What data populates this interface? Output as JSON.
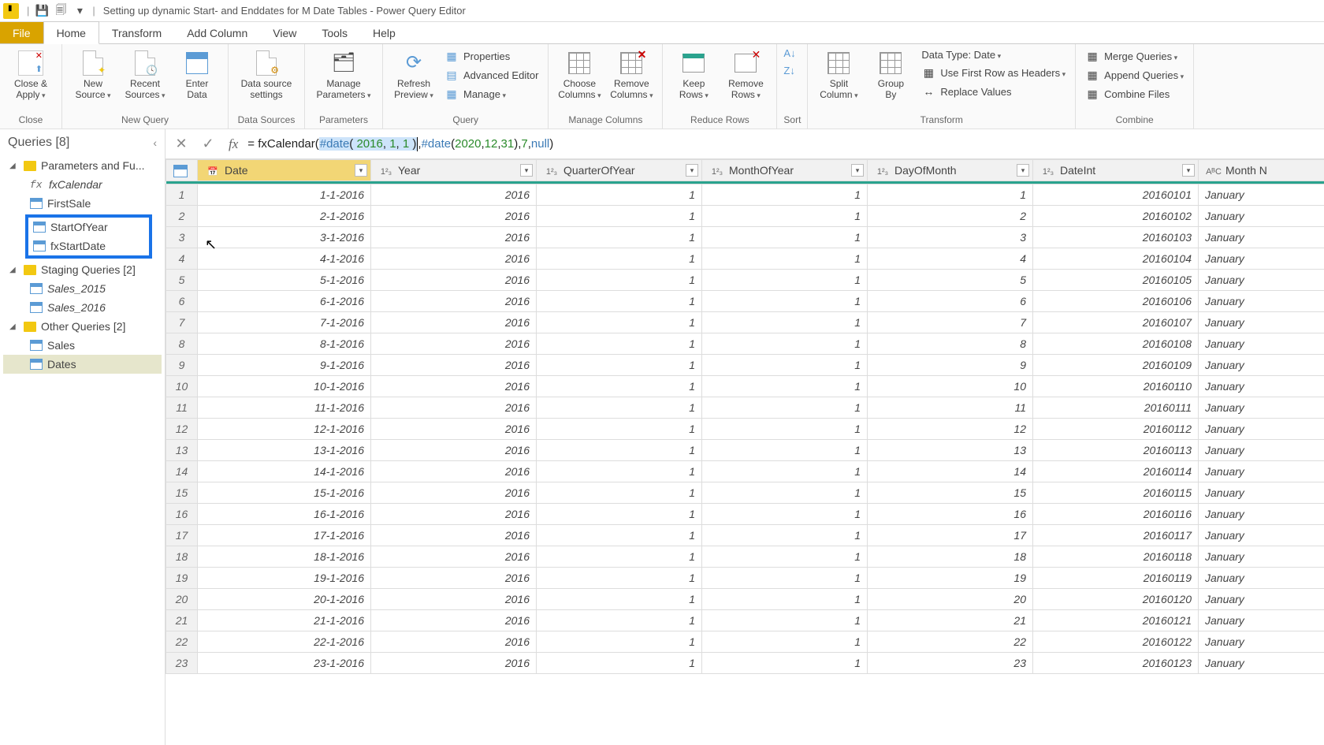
{
  "title": "Setting up dynamic Start- and Enddates for M Date Tables - Power Query Editor",
  "tabs": {
    "file": "File",
    "home": "Home",
    "transform": "Transform",
    "addcol": "Add Column",
    "view": "View",
    "tools": "Tools",
    "help": "Help"
  },
  "ribbon": {
    "close": {
      "closeapply": "Close &\nApply",
      "group": "Close"
    },
    "newquery": {
      "new": "New\nSource",
      "recent": "Recent\nSources",
      "enter": "Enter\nData",
      "group": "New Query"
    },
    "datasources": {
      "settings": "Data source\nsettings",
      "group": "Data Sources"
    },
    "parameters": {
      "manage": "Manage\nParameters",
      "group": "Parameters"
    },
    "query": {
      "refresh": "Refresh\nPreview",
      "properties": "Properties",
      "adveditor": "Advanced Editor",
      "manage": "Manage",
      "group": "Query"
    },
    "cols": {
      "choose": "Choose\nColumns",
      "remove": "Remove\nColumns",
      "group": "Manage Columns"
    },
    "rows": {
      "keep": "Keep\nRows",
      "remove": "Remove\nRows",
      "group": "Reduce Rows"
    },
    "sort": {
      "group": "Sort"
    },
    "transform": {
      "split": "Split\nColumn",
      "groupby": "Group\nBy",
      "datatype": "Data Type: Date",
      "firstrow": "Use First Row as Headers",
      "replace": "Replace Values",
      "group": "Transform"
    },
    "combine": {
      "merge": "Merge Queries",
      "append": "Append Queries",
      "combine": "Combine Files",
      "group": "Combine"
    }
  },
  "queries": {
    "title": "Queries [8]",
    "g1": "Parameters and Fu...",
    "fxcal": "fxCalendar",
    "firstsale": "FirstSale",
    "startofyear": "StartOfYear",
    "fxstartdate": "fxStartDate",
    "g2": "Staging Queries [2]",
    "s2015": "Sales_2015",
    "s2016": "Sales_2016",
    "g3": "Other Queries [2]",
    "sales": "Sales",
    "dates": "Dates"
  },
  "formula": {
    "p1": "= fxCalendar( ",
    "sel_kw": "#date",
    "sel_p": "(",
    "sel_n1": " 2016",
    "sel_c1": ", ",
    "sel_n2": "1",
    "sel_c2": ", ",
    "sel_n3": "1 ",
    "sel_close": ")",
    "p2": ", ",
    "kw2": "#date",
    "p3": "( ",
    "n4": "2020",
    "p4": ", ",
    "n5": "12",
    "p5": ", ",
    "n6": "31",
    "p6": "), ",
    "n7": "7",
    "p7": ", ",
    "kw3": "null",
    "p8": ")"
  },
  "columns": [
    "Date",
    "Year",
    "QuarterOfYear",
    "MonthOfYear",
    "DayOfMonth",
    "DateInt",
    "Month N"
  ],
  "coltypes": [
    "📅",
    "1²₃",
    "1²₃",
    "1²₃",
    "1²₃",
    "1²₃",
    "AᴮC"
  ],
  "rows": [
    {
      "n": 1,
      "date": "1-1-2016",
      "year": 2016,
      "q": 1,
      "m": 1,
      "d": 1,
      "di": 20160101,
      "mn": "January"
    },
    {
      "n": 2,
      "date": "2-1-2016",
      "year": 2016,
      "q": 1,
      "m": 1,
      "d": 2,
      "di": 20160102,
      "mn": "January"
    },
    {
      "n": 3,
      "date": "3-1-2016",
      "year": 2016,
      "q": 1,
      "m": 1,
      "d": 3,
      "di": 20160103,
      "mn": "January"
    },
    {
      "n": 4,
      "date": "4-1-2016",
      "year": 2016,
      "q": 1,
      "m": 1,
      "d": 4,
      "di": 20160104,
      "mn": "January"
    },
    {
      "n": 5,
      "date": "5-1-2016",
      "year": 2016,
      "q": 1,
      "m": 1,
      "d": 5,
      "di": 20160105,
      "mn": "January"
    },
    {
      "n": 6,
      "date": "6-1-2016",
      "year": 2016,
      "q": 1,
      "m": 1,
      "d": 6,
      "di": 20160106,
      "mn": "January"
    },
    {
      "n": 7,
      "date": "7-1-2016",
      "year": 2016,
      "q": 1,
      "m": 1,
      "d": 7,
      "di": 20160107,
      "mn": "January"
    },
    {
      "n": 8,
      "date": "8-1-2016",
      "year": 2016,
      "q": 1,
      "m": 1,
      "d": 8,
      "di": 20160108,
      "mn": "January"
    },
    {
      "n": 9,
      "date": "9-1-2016",
      "year": 2016,
      "q": 1,
      "m": 1,
      "d": 9,
      "di": 20160109,
      "mn": "January"
    },
    {
      "n": 10,
      "date": "10-1-2016",
      "year": 2016,
      "q": 1,
      "m": 1,
      "d": 10,
      "di": 20160110,
      "mn": "January"
    },
    {
      "n": 11,
      "date": "11-1-2016",
      "year": 2016,
      "q": 1,
      "m": 1,
      "d": 11,
      "di": 20160111,
      "mn": "January"
    },
    {
      "n": 12,
      "date": "12-1-2016",
      "year": 2016,
      "q": 1,
      "m": 1,
      "d": 12,
      "di": 20160112,
      "mn": "January"
    },
    {
      "n": 13,
      "date": "13-1-2016",
      "year": 2016,
      "q": 1,
      "m": 1,
      "d": 13,
      "di": 20160113,
      "mn": "January"
    },
    {
      "n": 14,
      "date": "14-1-2016",
      "year": 2016,
      "q": 1,
      "m": 1,
      "d": 14,
      "di": 20160114,
      "mn": "January"
    },
    {
      "n": 15,
      "date": "15-1-2016",
      "year": 2016,
      "q": 1,
      "m": 1,
      "d": 15,
      "di": 20160115,
      "mn": "January"
    },
    {
      "n": 16,
      "date": "16-1-2016",
      "year": 2016,
      "q": 1,
      "m": 1,
      "d": 16,
      "di": 20160116,
      "mn": "January"
    },
    {
      "n": 17,
      "date": "17-1-2016",
      "year": 2016,
      "q": 1,
      "m": 1,
      "d": 17,
      "di": 20160117,
      "mn": "January"
    },
    {
      "n": 18,
      "date": "18-1-2016",
      "year": 2016,
      "q": 1,
      "m": 1,
      "d": 18,
      "di": 20160118,
      "mn": "January"
    },
    {
      "n": 19,
      "date": "19-1-2016",
      "year": 2016,
      "q": 1,
      "m": 1,
      "d": 19,
      "di": 20160119,
      "mn": "January"
    },
    {
      "n": 20,
      "date": "20-1-2016",
      "year": 2016,
      "q": 1,
      "m": 1,
      "d": 20,
      "di": 20160120,
      "mn": "January"
    },
    {
      "n": 21,
      "date": "21-1-2016",
      "year": 2016,
      "q": 1,
      "m": 1,
      "d": 21,
      "di": 20160121,
      "mn": "January"
    },
    {
      "n": 22,
      "date": "22-1-2016",
      "year": 2016,
      "q": 1,
      "m": 1,
      "d": 22,
      "di": 20160122,
      "mn": "January"
    },
    {
      "n": 23,
      "date": "23-1-2016",
      "year": 2016,
      "q": 1,
      "m": 1,
      "d": 23,
      "di": 20160123,
      "mn": "January"
    }
  ]
}
